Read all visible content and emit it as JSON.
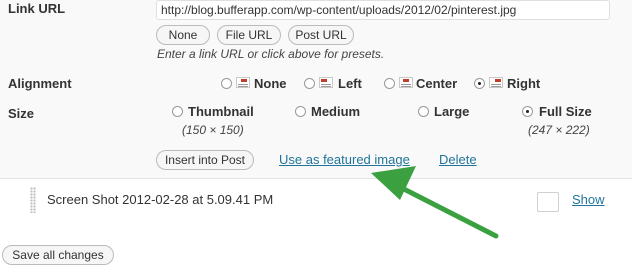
{
  "link_url": {
    "label": "Link URL",
    "value": "http://blog.bufferapp.com/wp-content/uploads/2012/02/pinterest.jpg",
    "presets": [
      "None",
      "File URL",
      "Post URL"
    ],
    "help": "Enter a link URL or click above for presets."
  },
  "alignment": {
    "label": "Alignment",
    "options": [
      "None",
      "Left",
      "Center",
      "Right"
    ],
    "selected": "Right"
  },
  "size": {
    "label": "Size",
    "options": [
      {
        "label": "Thumbnail",
        "dims": "(150 × 150)"
      },
      {
        "label": "Medium",
        "dims": ""
      },
      {
        "label": "Large",
        "dims": ""
      },
      {
        "label": "Full Size",
        "dims": "(247 × 222)"
      }
    ],
    "selected": "Full Size"
  },
  "actions": {
    "insert": "Insert into Post",
    "featured": "Use as featured image",
    "delete": "Delete"
  },
  "attachment": {
    "title": "Screen Shot 2012-02-28 at 5.09.41 PM",
    "show": "Show"
  },
  "save_all": "Save all changes",
  "colors": {
    "link": "#21759b",
    "arrow": "#3aa040",
    "align_block": "#c53b2a"
  }
}
